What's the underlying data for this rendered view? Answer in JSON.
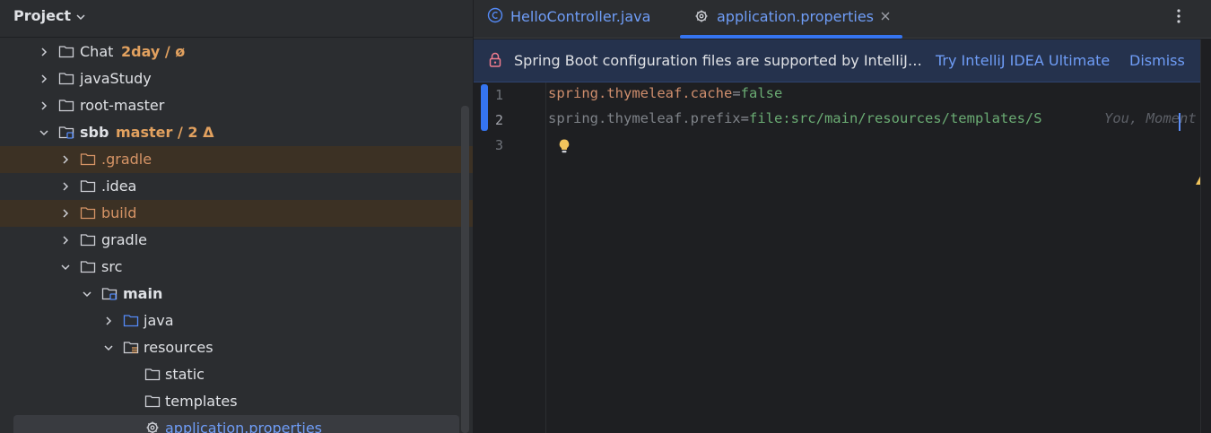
{
  "project_panel": {
    "title": "Project",
    "tree": [
      {
        "label": "Chat",
        "vcs": "2day / ø"
      },
      {
        "label": "javaStudy"
      },
      {
        "label": "root-master"
      },
      {
        "label": "sbb",
        "vcs": "master / 2 Δ"
      },
      {
        "label": ".gradle"
      },
      {
        "label": ".idea"
      },
      {
        "label": "build"
      },
      {
        "label": "gradle"
      },
      {
        "label": "src"
      },
      {
        "label": "main"
      },
      {
        "label": "java"
      },
      {
        "label": "resources"
      },
      {
        "label": "static"
      },
      {
        "label": "templates"
      },
      {
        "label": "application.properties"
      }
    ]
  },
  "tabs": [
    {
      "label": "HelloController.java",
      "icon": "java-class-icon",
      "active": false
    },
    {
      "label": "application.properties",
      "icon": "gear-icon",
      "active": true
    }
  ],
  "banner": {
    "text": "Spring Boot configuration files are supported by IntelliJ…",
    "try_label": "Try IntelliJ IDEA Ultimate",
    "dismiss_label": "Dismiss"
  },
  "editor": {
    "line_numbers": [
      "1",
      "2",
      "3"
    ],
    "line1": {
      "key": "spring.thymeleaf.cache",
      "eq": "=",
      "value": "false"
    },
    "line2": {
      "key": "spring.thymeleaf.prefix",
      "eq": "=",
      "value": "file:src/main/resources/templates/S"
    },
    "inline_blame": "You, Moment",
    "warning_count": "1"
  },
  "colors": {
    "accent": "#3574f0",
    "link": "#6f9df7",
    "excluded_folder_bg": "#3c3124",
    "vcs_branch": "#e2a15f",
    "property_key": "#cf8e6d",
    "property_value": "#6aab73",
    "warning": "#f2c55c"
  }
}
